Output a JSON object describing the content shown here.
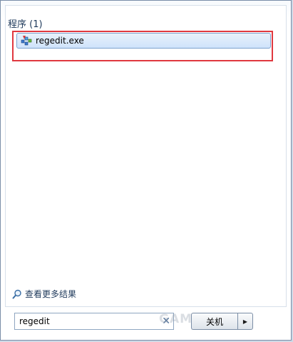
{
  "results": {
    "section_header": "程序 (1)",
    "items": [
      {
        "label": "regedit.exe",
        "icon": "regedit-icon"
      }
    ]
  },
  "see_more": {
    "label": "查看更多结果",
    "icon": "search-icon"
  },
  "search": {
    "value": "regedit",
    "clear_icon": "clear-icon"
  },
  "shutdown": {
    "label": "关机",
    "arrow_icon": "triangle-right-icon"
  },
  "watermark": {
    "text": "GAMERSKY"
  },
  "colors": {
    "highlight_border": "#e0383f",
    "selected_item_bg": "#cfe3fb",
    "header_text": "#1e395b"
  }
}
